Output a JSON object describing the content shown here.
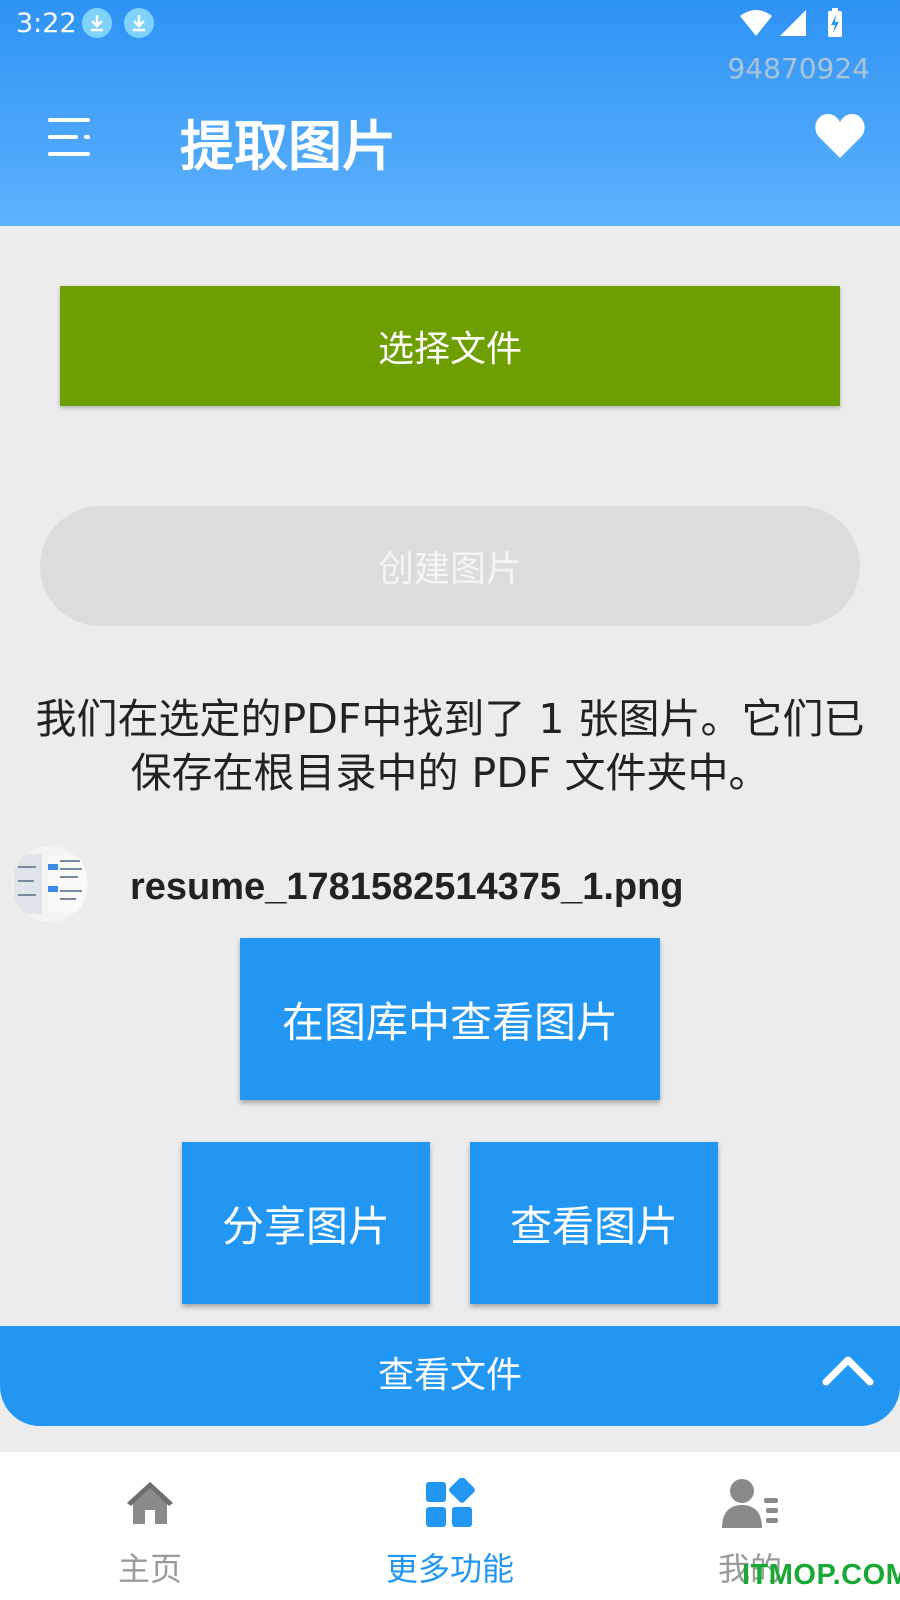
{
  "status_bar": {
    "time": "3:22",
    "icons": [
      "download-icon",
      "download-icon",
      "wifi-icon",
      "signal-icon",
      "battery-charging-icon"
    ],
    "build_id": "94870924"
  },
  "header": {
    "title": "提取图片",
    "menu_icon": "menu-icon",
    "favorite_icon": "heart-icon"
  },
  "main": {
    "select_file_label": "选择文件",
    "create_image_label": "创建图片",
    "result_message": "我们在选定的PDF中找到了 1 张图片。它们已保存在根目录中的 PDF 文件夹中。",
    "file": {
      "name": "resume_1781582514375_1.png"
    },
    "view_in_gallery_label": "在图库中查看图片",
    "share_image_label": "分享图片",
    "view_image_label": "查看图片",
    "view_files_label": "查看文件"
  },
  "bottom_nav": {
    "items": [
      {
        "label": "主页",
        "icon": "home-icon",
        "active": false
      },
      {
        "label": "更多功能",
        "icon": "grid-icon",
        "active": true
      },
      {
        "label": "我的",
        "icon": "profile-icon",
        "active": false
      }
    ]
  },
  "watermark": "ITMOP.COM",
  "colors": {
    "header_top": "#2d93f5",
    "header_bottom": "#5db2fc",
    "select_button": "#6e9f00",
    "primary_button": "#2196f3",
    "disabled_button": "#dcdcdc",
    "nav_active": "#2196f3",
    "nav_inactive": "#9a9a9a",
    "watermark": "#18a834"
  }
}
